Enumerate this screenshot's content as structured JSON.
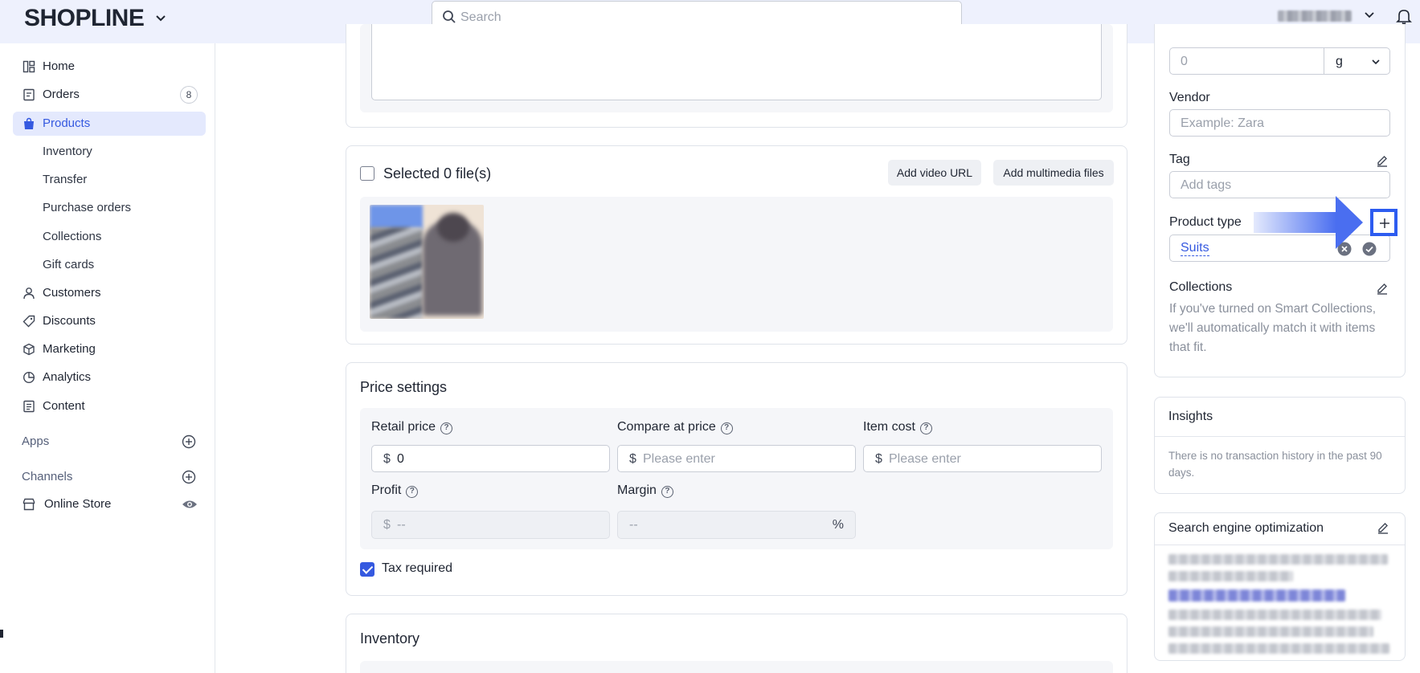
{
  "header": {
    "logo": "SHOPLINE",
    "search_placeholder": "Search"
  },
  "sidebar": {
    "items": [
      {
        "label": "Home",
        "icon": "home-icon"
      },
      {
        "label": "Orders",
        "icon": "orders-icon",
        "badge": "8"
      },
      {
        "label": "Products",
        "icon": "products-icon",
        "active": true
      },
      {
        "label": "Inventory"
      },
      {
        "label": "Transfer"
      },
      {
        "label": "Purchase orders"
      },
      {
        "label": "Collections"
      },
      {
        "label": "Gift cards"
      },
      {
        "label": "Customers",
        "icon": "customers-icon"
      },
      {
        "label": "Discounts",
        "icon": "discounts-icon"
      },
      {
        "label": "Marketing",
        "icon": "marketing-icon"
      },
      {
        "label": "Analytics",
        "icon": "analytics-icon"
      },
      {
        "label": "Content",
        "icon": "content-icon"
      }
    ],
    "apps_label": "Apps",
    "channels_label": "Channels",
    "online_store_label": "Online Store"
  },
  "media": {
    "selected_label": "Selected 0 file(s)",
    "add_video_url": "Add video URL",
    "add_multimedia": "Add multimedia files"
  },
  "price": {
    "title": "Price settings",
    "retail_label": "Retail price",
    "retail_currency": "$",
    "retail_value": "0",
    "compare_label": "Compare at price",
    "compare_currency": "$",
    "compare_placeholder": "Please enter",
    "cost_label": "Item cost",
    "cost_currency": "$",
    "cost_placeholder": "Please enter",
    "profit_label": "Profit",
    "profit_currency": "$",
    "profit_value": "--",
    "margin_label": "Margin",
    "margin_value": "--",
    "margin_unit": "%",
    "tax_label": "Tax required"
  },
  "inventory": {
    "title": "Inventory"
  },
  "right_panel": {
    "weight_value": "0",
    "weight_unit": "g",
    "vendor_label": "Vendor",
    "vendor_placeholder": "Example: Zara",
    "tag_label": "Tag",
    "tag_placeholder": "Add tags",
    "product_type_label": "Product type",
    "product_type_value": "Suits",
    "collections_label": "Collections",
    "collections_hint": "If you've turned on Smart Collections, we'll automatically match it with items that fit.",
    "insights_title": "Insights",
    "insights_text": "There is no transaction history in the past 90 days.",
    "seo_title": "Search engine optimization"
  },
  "colors": {
    "accent": "#3559e0",
    "header_bg": "#eef1fd",
    "annotation_arrow": "#4a6ef0"
  }
}
